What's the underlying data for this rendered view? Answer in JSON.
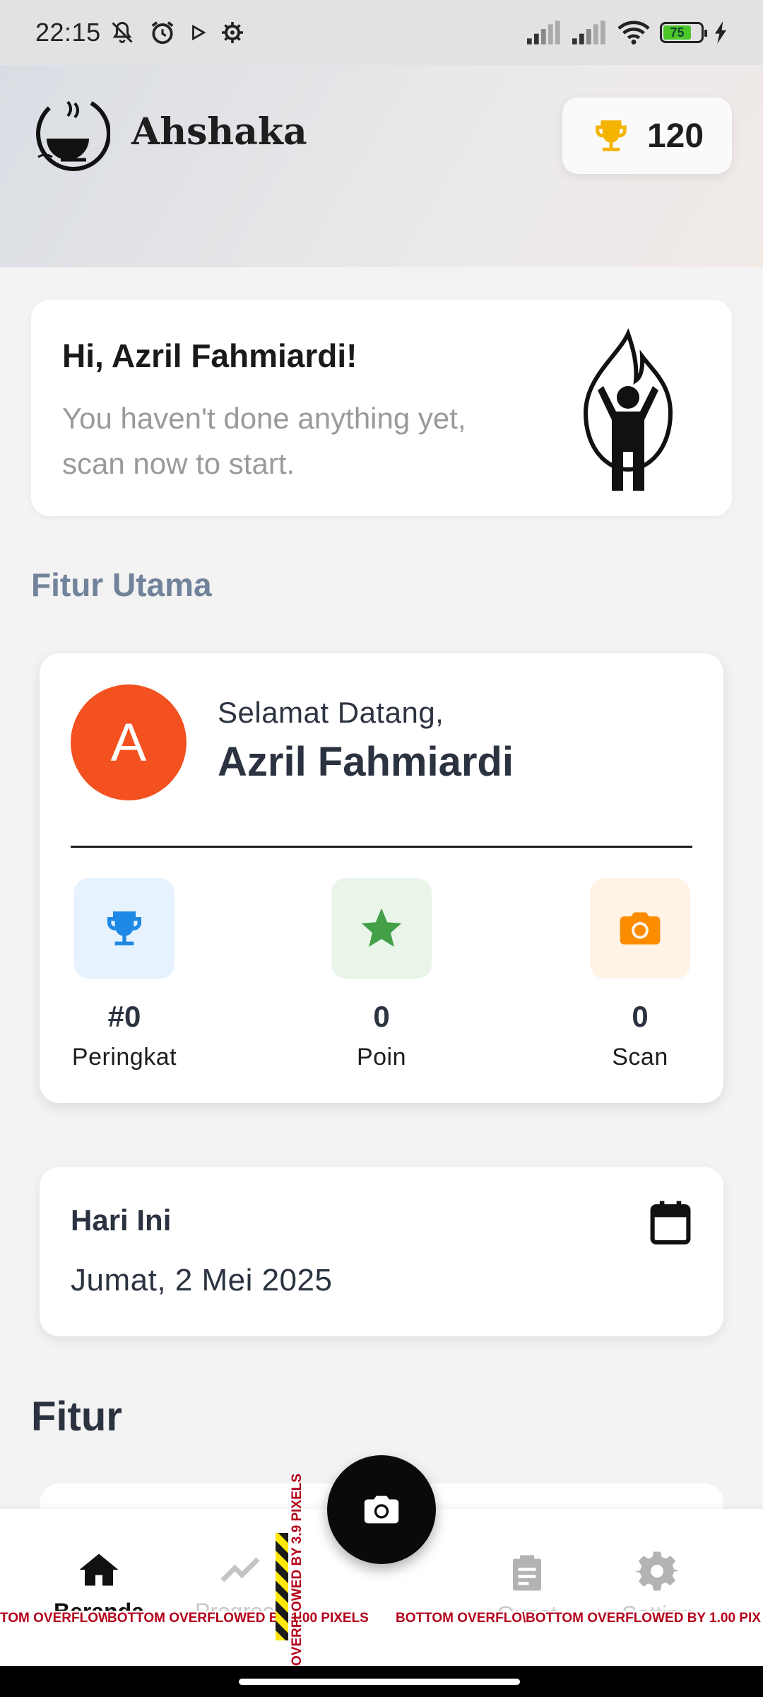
{
  "status_bar": {
    "time": "22:15",
    "battery": "75",
    "icons": [
      "mute-icon",
      "alarm-icon",
      "play-icon",
      "settings-gear-icon",
      "signal-icon",
      "signal-icon",
      "wifi-icon",
      "battery-icon",
      "charging-icon"
    ]
  },
  "header": {
    "app_name": "Ahshaka",
    "points": "120",
    "points_icon": "trophy-icon",
    "accent": "#f5b400"
  },
  "greeting": {
    "title": "Hi, Azril Fahmiardi!",
    "subtitle": "You haven't done anything yet, scan now to start."
  },
  "section_main": "Fitur Utama",
  "profile_card": {
    "avatar_letter": "A",
    "avatar_color": "#f3511f",
    "welcome": "Selamat Datang,",
    "name": "Azril Fahmiardi",
    "stats": [
      {
        "icon": "trophy-icon",
        "value": "#0",
        "label": "Peringkat",
        "color": "#1e88e5",
        "bg": "#e6f2fd"
      },
      {
        "icon": "star-icon",
        "value": "0",
        "label": "Poin",
        "color": "#43a047",
        "bg": "#eaf5ea"
      },
      {
        "icon": "camera-icon",
        "value": "0",
        "label": "Scan",
        "color": "#fb8c00",
        "bg": "#fff3e6"
      }
    ]
  },
  "today": {
    "title": "Hari Ini",
    "date": "Jumat, 2 Mei 2025"
  },
  "section_features": "Fitur",
  "bottom_nav": {
    "items": [
      {
        "label": "Beranda",
        "icon": "home-icon",
        "active": true
      },
      {
        "label": "Progress",
        "icon": "trending-icon",
        "active": false
      },
      {
        "label": "Quest",
        "icon": "clipboard-icon",
        "active": false
      },
      {
        "label": "Setting",
        "icon": "gear-icon",
        "active": false
      }
    ],
    "fab_icon": "camera-icon"
  },
  "overflow_messages": {
    "a": "TOM OVERFLOW",
    "b": "BOTTOM OVERFLOWED BY 1.00 PIXELS",
    "c": "BOTTOM OVERFLO\\",
    "d": "BOTTOM OVERFLOWED BY 1.00 PIX",
    "vertical": "OVERFLOWED BY 3.9 PIXELS"
  }
}
